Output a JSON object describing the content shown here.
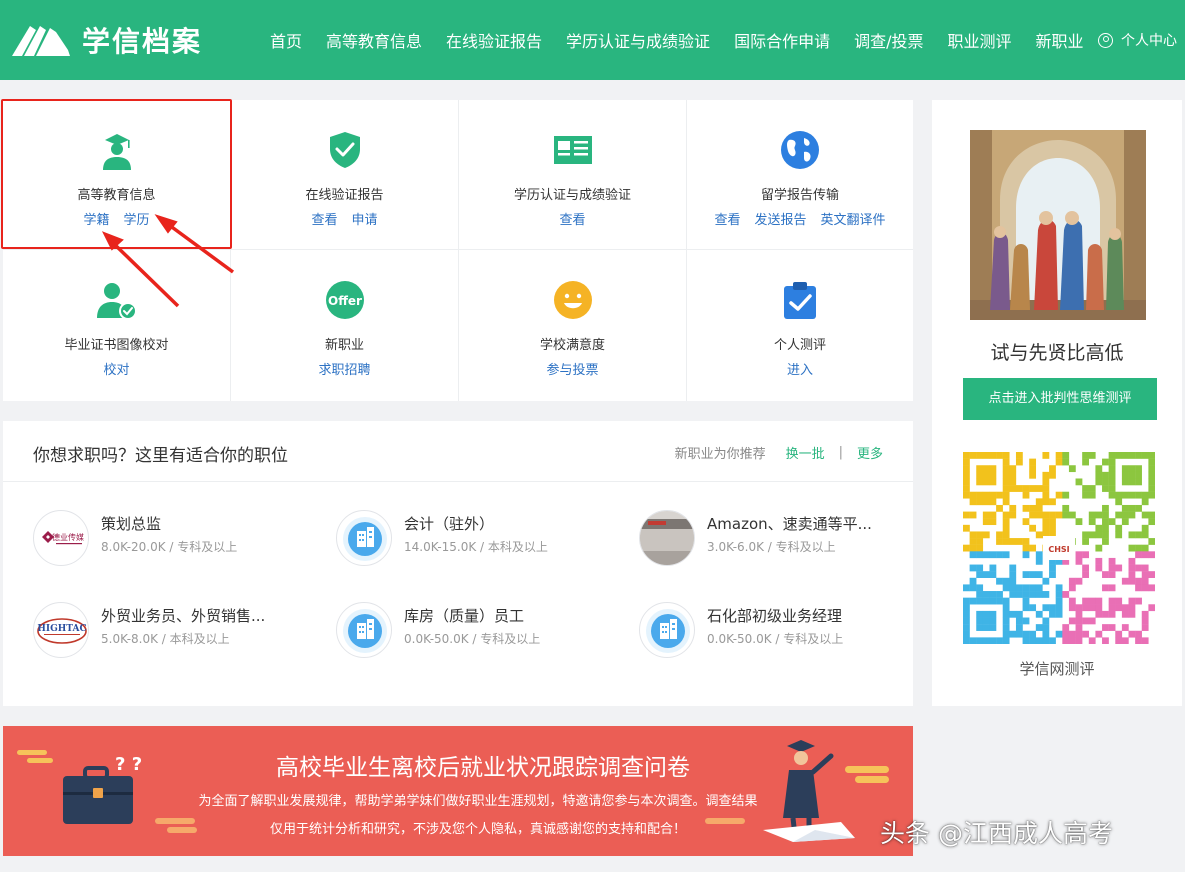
{
  "brand": {
    "name": "学信档案",
    "color": "#29b57f"
  },
  "nav": {
    "items": [
      "首页",
      "高等教育信息",
      "在线验证报告",
      "学历认证与成绩验证",
      "国际合作申请",
      "调查/投票",
      "职业测评",
      "新职业"
    ],
    "user_center": "个人中心"
  },
  "services": [
    {
      "title": "高等教育信息",
      "links": [
        "学籍",
        "学历"
      ],
      "icon": "graduate-icon"
    },
    {
      "title": "在线验证报告",
      "links": [
        "查看",
        "申请"
      ],
      "icon": "shield-check-icon"
    },
    {
      "title": "学历认证与成绩验证",
      "links": [
        "查看"
      ],
      "icon": "id-card-icon"
    },
    {
      "title": "留学报告传输",
      "links": [
        "查看",
        "发送报告",
        "英文翻译件"
      ],
      "icon": "globe-icon"
    },
    {
      "title": "毕业证书图像校对",
      "links": [
        "校对"
      ],
      "icon": "user-check-icon"
    },
    {
      "title": "新职业",
      "links": [
        "求职招聘"
      ],
      "icon": "offer-icon",
      "icon_text": "Offer"
    },
    {
      "title": "学校满意度",
      "links": [
        "参与投票"
      ],
      "icon": "smiley-icon"
    },
    {
      "title": "个人测评",
      "links": [
        "进入"
      ],
      "icon": "clipboard-check-icon"
    }
  ],
  "jobs": {
    "title": "你想求职吗？这里有适合你的职位",
    "recommend": "新职业为你推荐",
    "refresh": "换一批",
    "separator": "|",
    "more": "更多",
    "items": [
      {
        "title": "策划总监",
        "meta": "8.0K-20.0K  /  专科及以上",
        "avatar": "company-logo-1",
        "logo_text": "德业传媒"
      },
      {
        "title": "会计（驻外）",
        "meta": "14.0K-15.0K  /  本科及以上",
        "avatar": "building-icon"
      },
      {
        "title": "Amazon、速卖通等平...",
        "meta": "3.0K-6.0K  /  专科及以上",
        "avatar": "office-photo"
      },
      {
        "title": "外贸业务员、外贸销售...",
        "meta": "5.0K-8.0K  /  本科及以上",
        "avatar": "company-logo-2",
        "logo_text": "HIGHTAC"
      },
      {
        "title": "库房（质量）员工",
        "meta": "0.0K-50.0K  /  专科及以上",
        "avatar": "building-icon"
      },
      {
        "title": "石化部初级业务经理",
        "meta": "0.0K-50.0K  /  专科及以上",
        "avatar": "building-icon"
      }
    ]
  },
  "side": {
    "title": "试与先贤比高低",
    "button": "点击进入批判性思维测评",
    "caption": "学信网测评",
    "qr_label": "CHSI"
  },
  "banner": {
    "title": "高校毕业生离校后就业状况跟踪调查问卷",
    "text": "为全面了解职业发展规律，帮助学弟学妹们做好职业生涯规划，特邀请您参与本次调查。调查结果仅用于统计分析和研究，不涉及您个人隐私，真诚感谢您的支持和配合！",
    "marks": "? ?"
  },
  "watermark": "头条 @江西成人高考"
}
